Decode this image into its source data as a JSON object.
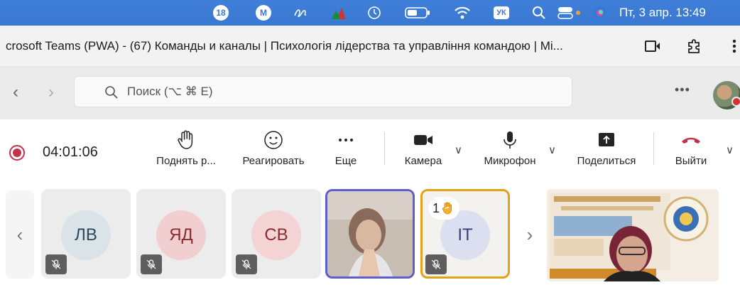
{
  "menubar": {
    "badge_count": "18",
    "m_letter": "M",
    "keyboard_layout": "УК",
    "clock": "Пт, 3 апр.  13:49"
  },
  "window": {
    "title": "crosoft Teams (PWA) - (67) Команды и каналы | Психологія лідерства та управління командою | Mi..."
  },
  "search": {
    "placeholder": "Поиск (⌥ ⌘ E)"
  },
  "call": {
    "timer": "04:01:06",
    "controls": {
      "raise_hand": "Поднять р...",
      "react": "Реагировать",
      "more": "Еще",
      "camera": "Камера",
      "microphone": "Микрофон",
      "share": "Поделиться",
      "leave": "Выйти"
    },
    "colors": {
      "leave": "#c4314b",
      "record": "#c4314b",
      "menubar": "#3b78d2"
    }
  },
  "participants": [
    {
      "initials": "ЛВ",
      "bg": "#d9e3e8",
      "fg": "#2b4a5a",
      "muted": true
    },
    {
      "initials": "ЯД",
      "bg": "#f1cfd0",
      "fg": "#8a2a2e",
      "muted": true
    },
    {
      "initials": "СВ",
      "bg": "#f3d3d3",
      "fg": "#8c2b30",
      "muted": true
    },
    {
      "video": true,
      "active_speaker": true
    },
    {
      "initials": "ІТ",
      "bg": "#dcdff0",
      "fg": "#3a3f7a",
      "muted": true,
      "hand_raised": true,
      "hand_order": "1"
    }
  ]
}
